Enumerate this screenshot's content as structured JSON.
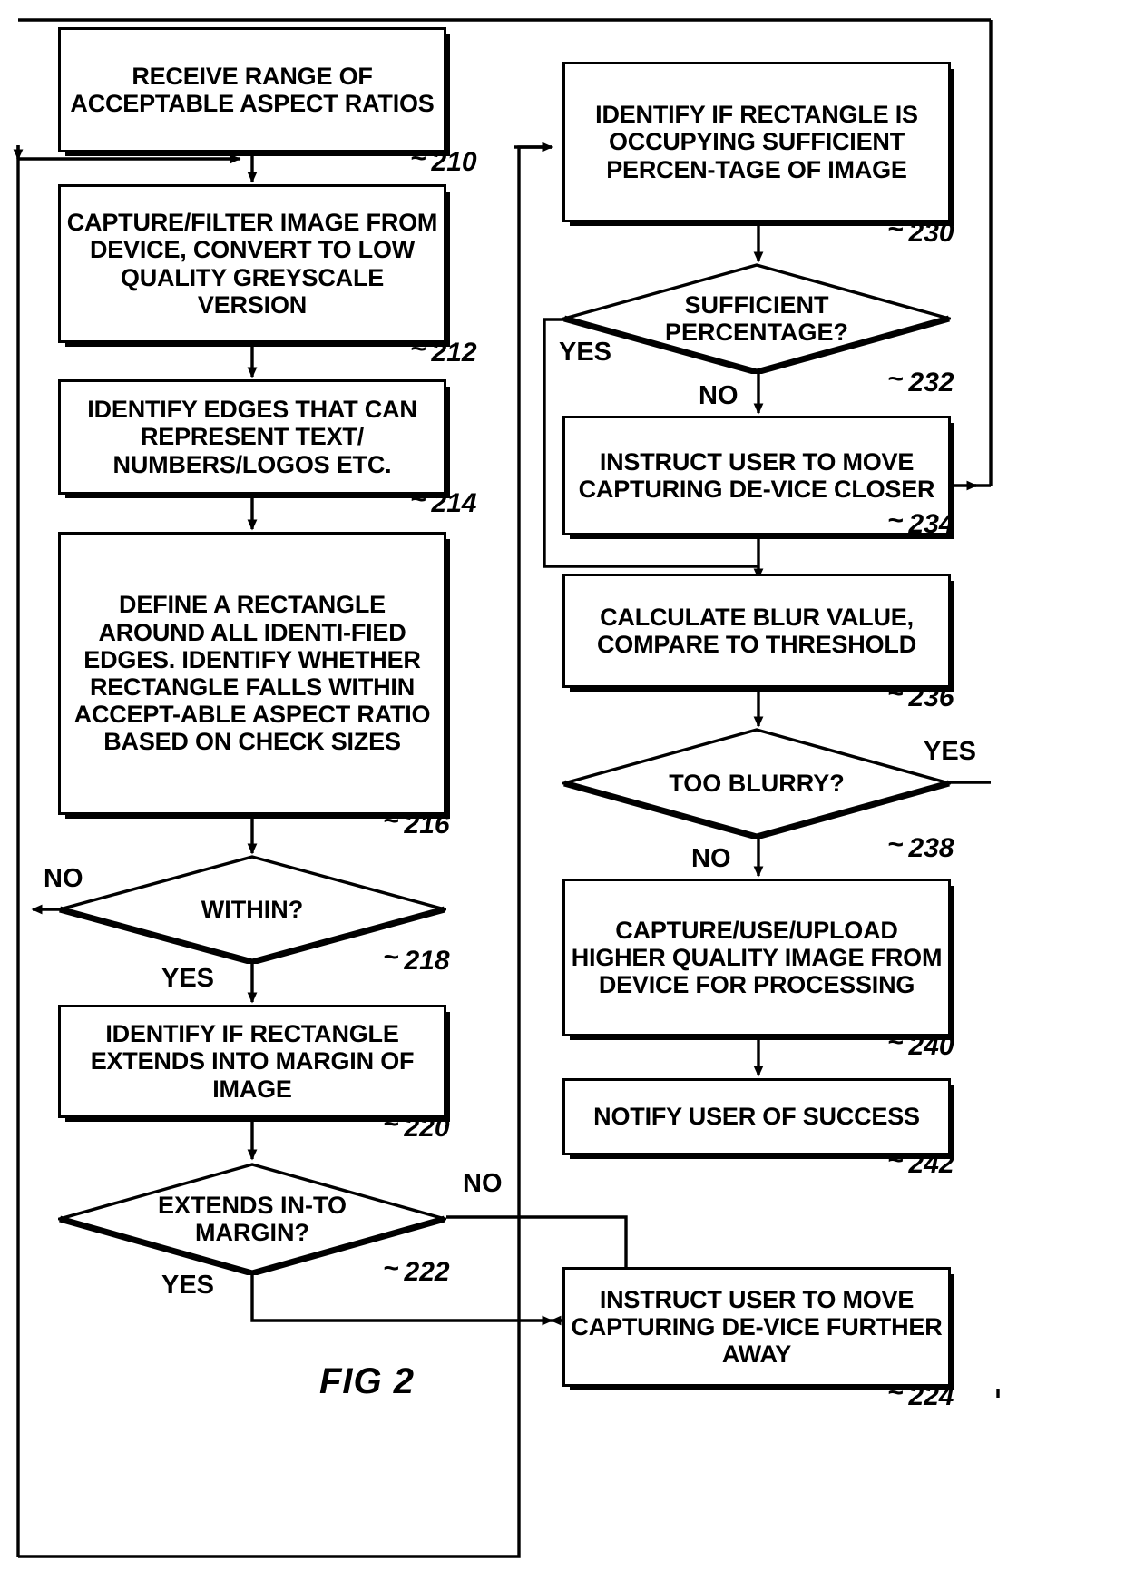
{
  "figure": {
    "label": "FIG 2",
    "colors": {
      "ink": "#000000",
      "paper": "#ffffff"
    }
  },
  "nodes": {
    "n210": {
      "text": "RECEIVE RANGE OF ACCEPTABLE ASPECT RATIOS",
      "ref": "210",
      "shape": "process"
    },
    "n212": {
      "text": "CAPTURE/FILTER IMAGE FROM DEVICE, CONVERT TO LOW QUALITY GREYSCALE VERSION",
      "ref": "212",
      "shape": "process"
    },
    "n214": {
      "text": "IDENTIFY EDGES THAT CAN REPRESENT TEXT/ NUMBERS/LOGOS ETC.",
      "ref": "214",
      "shape": "process"
    },
    "n216": {
      "text": "DEFINE A RECTANGLE AROUND ALL IDENTI-FIED EDGES.  IDENTIFY WHETHER RECTANGLE FALLS WITHIN ACCEPT-ABLE ASPECT RATIO BASED ON CHECK SIZES",
      "ref": "216",
      "shape": "process"
    },
    "n218": {
      "text": "WITHIN?",
      "ref": "218",
      "shape": "decision"
    },
    "n220": {
      "text": "IDENTIFY IF RECTANGLE EXTENDS INTO MARGIN OF IMAGE",
      "ref": "220",
      "shape": "process"
    },
    "n222": {
      "text": "EXTENDS IN-TO MARGIN?",
      "ref": "222",
      "shape": "decision"
    },
    "n224": {
      "text": "INSTRUCT USER TO MOVE CAPTURING DE-VICE FURTHER AWAY",
      "ref": "224",
      "shape": "process"
    },
    "n230": {
      "text": "IDENTIFY IF RECTANGLE IS OCCUPYING SUFFICIENT PERCEN-TAGE OF IMAGE",
      "ref": "230",
      "shape": "process"
    },
    "n232": {
      "text": "SUFFICIENT PERCENTAGE?",
      "ref": "232",
      "shape": "decision"
    },
    "n234": {
      "text": "INSTRUCT USER TO MOVE CAPTURING DE-VICE CLOSER",
      "ref": "234",
      "shape": "process"
    },
    "n236": {
      "text": "CALCULATE BLUR VALUE, COMPARE TO THRESHOLD",
      "ref": "236",
      "shape": "process"
    },
    "n238": {
      "text": "TOO BLURRY?",
      "ref": "238",
      "shape": "decision"
    },
    "n240": {
      "text": "CAPTURE/USE/UPLOAD HIGHER QUALITY IMAGE FROM DEVICE FOR PROCESSING",
      "ref": "240",
      "shape": "process"
    },
    "n242": {
      "text": "NOTIFY USER OF SUCCESS",
      "ref": "242",
      "shape": "process"
    }
  },
  "edge_labels": {
    "within_no": "NO",
    "within_yes": "YES",
    "margin_no": "NO",
    "margin_yes": "YES",
    "percentage_yes": "YES",
    "percentage_no": "NO",
    "blurry_yes": "YES",
    "blurry_no": "NO"
  }
}
